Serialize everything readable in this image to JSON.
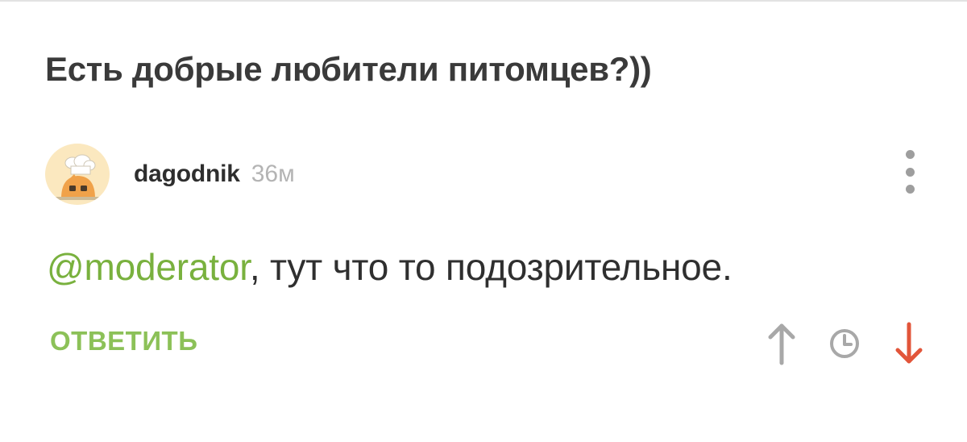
{
  "post": {
    "title": "Есть добрые любители питомцев?))"
  },
  "comment": {
    "avatar_icon": "chef-character-icon",
    "username": "dagodnik",
    "time": "36м",
    "mention": "@moderator",
    "text": ", тут что то подозрительное.",
    "reply_label": "ОТВЕТИТЬ",
    "menu_icon": "more-vertical-icon"
  },
  "actions": {
    "upvote_icon": "arrow-up-icon",
    "history_icon": "clock-icon",
    "downvote_icon": "arrow-down-icon"
  },
  "colors": {
    "accent_green": "#79b13e",
    "reply_green": "#8cc158",
    "downvote_red": "#e2553a",
    "icon_gray": "#a8a8a8",
    "avatar_bg": "#fbe8bf"
  }
}
